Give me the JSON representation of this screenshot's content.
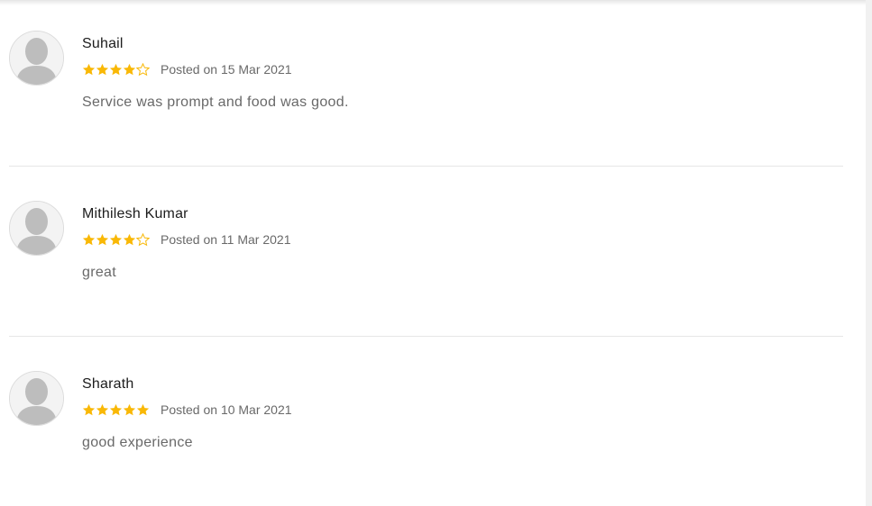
{
  "colors": {
    "star_filled": "#f9b806",
    "star_empty_stroke": "#f9b806",
    "avatar_bg": "#f3f3f3",
    "avatar_silhouette": "#bdbdbd",
    "divider": "#e6e6e6"
  },
  "reviews": [
    {
      "name": "Suhail",
      "rating": 4,
      "max_rating": 5,
      "posted": "Posted on 15 Mar 2021",
      "comment": "Service was prompt and food was good.",
      "avatar_icon": "user-silhouette-icon"
    },
    {
      "name": "Mithilesh Kumar",
      "rating": 4,
      "max_rating": 5,
      "posted": "Posted on 11 Mar 2021",
      "comment": "great",
      "avatar_icon": "user-silhouette-icon"
    },
    {
      "name": "Sharath",
      "rating": 5,
      "max_rating": 5,
      "posted": "Posted on 10 Mar 2021",
      "comment": "good experience",
      "avatar_icon": "user-silhouette-icon"
    }
  ]
}
